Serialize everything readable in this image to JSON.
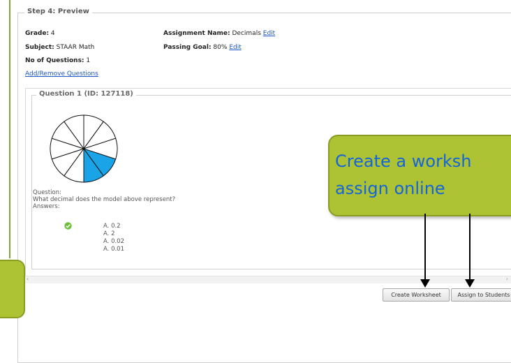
{
  "step_legend": "Step 4: Preview",
  "grade": {
    "label": "Grade:",
    "value": "4"
  },
  "subject": {
    "label": "Subject:",
    "value": "STAAR Math"
  },
  "num_questions": {
    "label": "No of Questions:",
    "value": "1"
  },
  "add_remove_link": "Add/Remove Questions",
  "assignment_name": {
    "label": "Assignment Name:",
    "value": "Decimals",
    "edit": "Edit"
  },
  "passing_goal": {
    "label": "Passing Goal:",
    "value": "80%",
    "edit": "Edit"
  },
  "question": {
    "legend": "Question 1 (ID: 127118)",
    "heading": "Question:",
    "text": "What decimal does the model above represent?",
    "answers_label": "Answers:",
    "answers": [
      "A.  0.2",
      "A.  2",
      "A.  0.02",
      "A.  0.01"
    ],
    "correct_index": 0,
    "model": {
      "total_parts": 10,
      "shaded_parts": 2,
      "shade_color": "#1aa3e6"
    }
  },
  "buttons": {
    "create_worksheet": "Create Worksheet",
    "assign_students": "Assign to Students"
  },
  "callout": {
    "line1": "Create a worksh",
    "line2": "assign online"
  },
  "colors": {
    "accent": "#adc334",
    "link": "#1a55c9"
  }
}
